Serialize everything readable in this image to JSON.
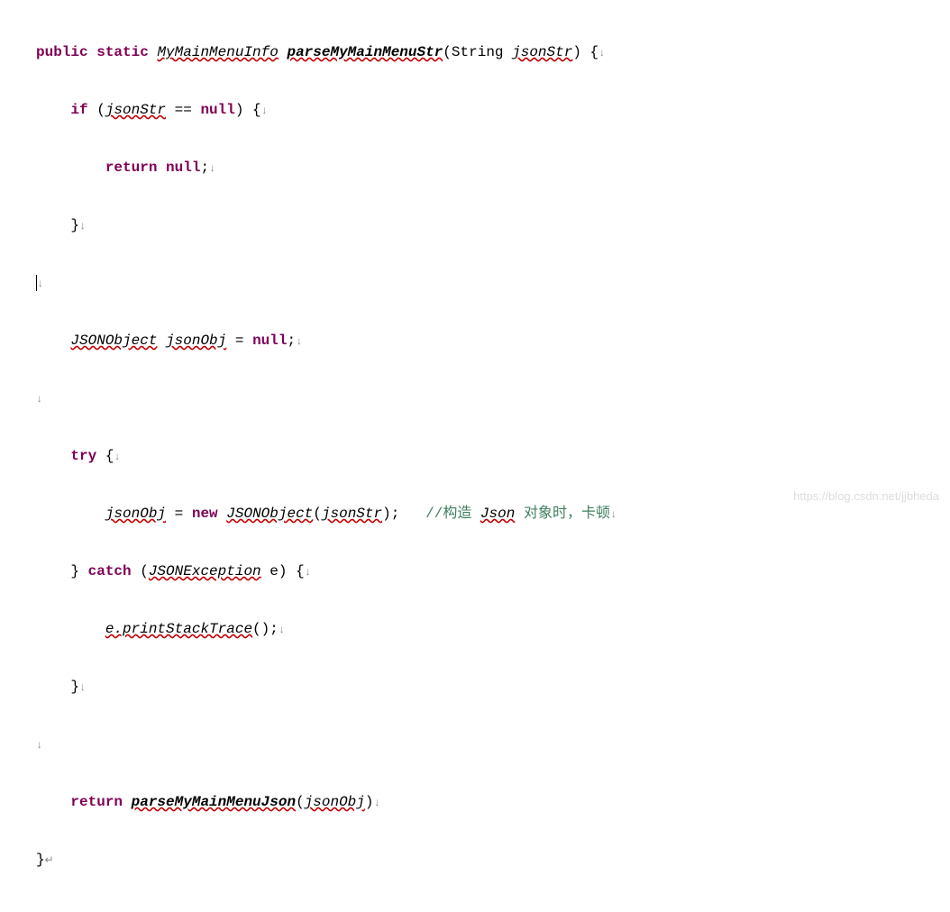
{
  "code": {
    "l1_kw1": "public static",
    "l1_type": "MyMainMenuInfo",
    "l1_method": "parseMyMainMenuStr",
    "l1_paren_open": "(",
    "l1_param_type": "String",
    "l1_param_name": "jsonStr",
    "l1_close": ") {",
    "l2_kw": "if",
    "l2_open": " (",
    "l2_var": "jsonStr",
    "l2_op": " == ",
    "l2_null": "null",
    "l2_close": ") {",
    "l3_kw": "return null",
    "l3_semi": ";",
    "l4_close": "}",
    "l6_type": "JSONObject",
    "l6_sp": " ",
    "l6_var": "jsonObj",
    "l6_rest": " = ",
    "l6_null": "null",
    "l6_semi": ";",
    "l8_kw": "try",
    "l8_open": " {",
    "l9_var": "jsonObj",
    "l9_eq": " = ",
    "l9_new": "new",
    "l9_sp": " ",
    "l9_type": "JSONObject",
    "l9_open": "(",
    "l9_arg": "jsonStr",
    "l9_close": ");   ",
    "l9_comment": "//构造 ",
    "l9_comment_json": "Json",
    "l9_comment_rest": " 对象时，卡顿",
    "l10_close": "} ",
    "l10_kw": "catch",
    "l10_open": " (",
    "l10_type": "JSONException",
    "l10_sp": " ",
    "l10_var": "e",
    "l10_close2": ") {",
    "l11_expr": "e.printStackTrace",
    "l11_rest": "();",
    "l12_close": "}",
    "l14_kw": "return",
    "l14_sp": " ",
    "l14_method": "parseMyMainMenuJson",
    "l14_open": "(",
    "l14_arg": "jsonObj",
    "l14_close": ")",
    "l15_close": "}"
  },
  "arrow": "↓",
  "arrow_end": "↵",
  "watermark": "https://blog.csdn.net/jjbheda"
}
